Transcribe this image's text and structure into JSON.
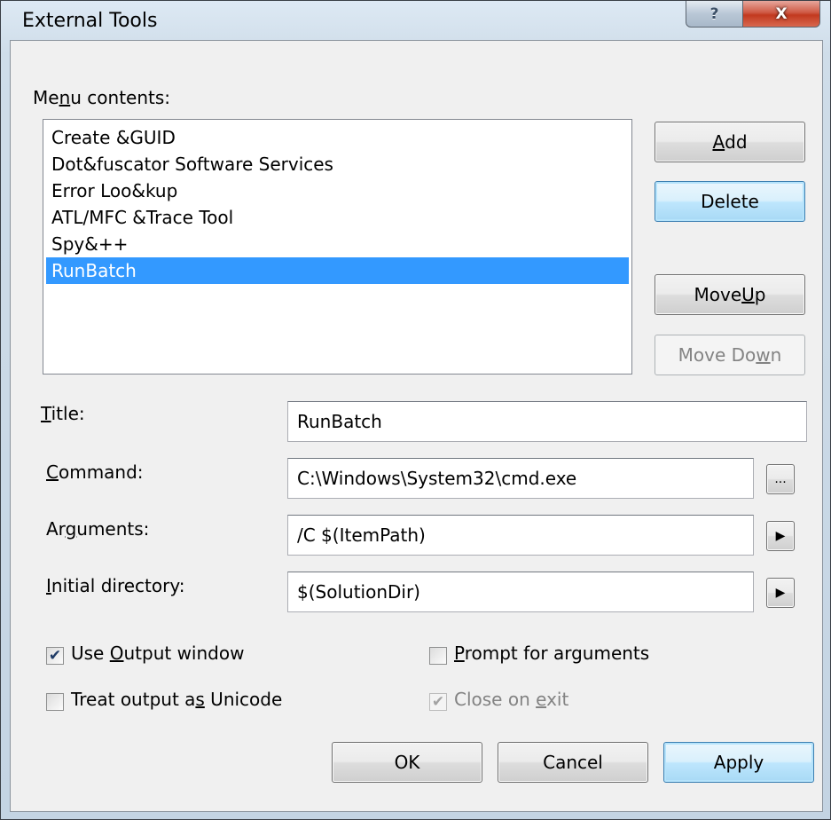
{
  "window": {
    "title": "External Tools",
    "help_glyph": "?",
    "close_glyph": "X"
  },
  "menu_contents": {
    "label_pre": "Me",
    "label_key": "n",
    "label_post": "u contents:",
    "items": [
      {
        "label": "Create &GUID",
        "selected": false
      },
      {
        "label": "Dot&fuscator Software Services",
        "selected": false
      },
      {
        "label": "Error Loo&kup",
        "selected": false
      },
      {
        "label": "ATL/MFC &Trace Tool",
        "selected": false
      },
      {
        "label": "Spy&++",
        "selected": false
      },
      {
        "label": "RunBatch",
        "selected": true
      }
    ]
  },
  "buttons": {
    "add": {
      "key": "A",
      "rest": "dd"
    },
    "delete": {
      "label": "Delete"
    },
    "move_up": {
      "pre": "Move ",
      "key": "U",
      "rest": "p"
    },
    "move_down": {
      "pre": "Move Do",
      "key": "w",
      "rest": "n"
    },
    "ok": "OK",
    "cancel": "Cancel",
    "apply": "Apply"
  },
  "fields": {
    "title": {
      "key": "T",
      "rest": "itle:",
      "value": "RunBatch"
    },
    "command": {
      "key": "C",
      "rest": "ommand:",
      "value": "C:\\Windows\\System32\\cmd.exe",
      "browse": "..."
    },
    "arguments": {
      "pre": "Ar",
      "key": "g",
      "rest": "uments:",
      "value": "/C $(ItemPath)",
      "menu_arrow": "▶"
    },
    "initial_directory": {
      "key": "I",
      "rest": "nitial directory:",
      "value": "$(SolutionDir)",
      "menu_arrow": "▶"
    }
  },
  "options": {
    "use_output_window": {
      "pre": "Use ",
      "key": "O",
      "rest": "utput window",
      "checked": true,
      "check_glyph": "✔"
    },
    "treat_output_unicode": {
      "pre": "Treat output a",
      "key": "s",
      "rest": " Unicode",
      "checked": false
    },
    "prompt_for_arguments": {
      "key": "P",
      "rest": "rompt for arguments",
      "checked": false
    },
    "close_on_exit": {
      "pre": "Close on ",
      "key": "e",
      "rest": "xit",
      "checked": true,
      "disabled": true,
      "check_glyph": "✔"
    }
  },
  "colors": {
    "selection": "#3399ff",
    "focus_border": "#3c7fb1",
    "close_red": "#c2391f"
  }
}
